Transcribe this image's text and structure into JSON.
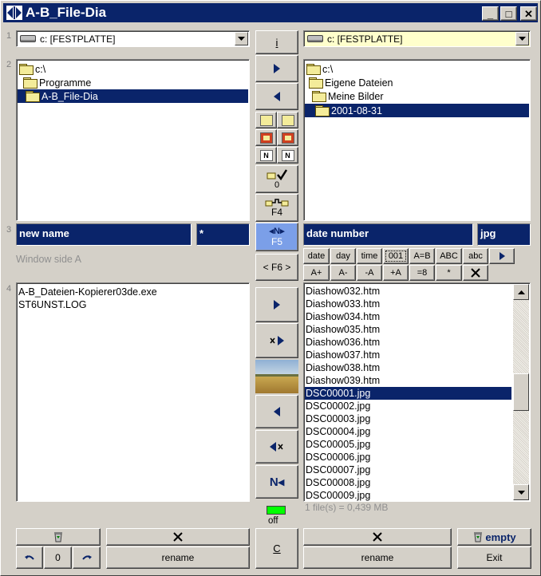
{
  "window": {
    "title": "A-B_File-Dia",
    "min_glyph": "_",
    "max_glyph": "□",
    "close_glyph": "✕"
  },
  "row_numbers": [
    "1",
    "2",
    "3",
    "4"
  ],
  "left": {
    "drive": "c: [FESTPLATTE]",
    "tree": [
      {
        "label": "c:\\",
        "indent": 0,
        "selected": false
      },
      {
        "label": "Programme",
        "indent": 1,
        "selected": false
      },
      {
        "label": "A-B_File-Dia",
        "indent": 2,
        "selected": true
      }
    ],
    "name_field": "new name",
    "ext_field": "*",
    "hint": "Window side A",
    "files": [
      "A-B_Dateien-Kopierer03de.exe",
      "ST6UNST.LOG"
    ]
  },
  "right": {
    "drive": "c: [FESTPLATTE]",
    "tree": [
      {
        "label": "c:\\",
        "indent": 0,
        "selected": false
      },
      {
        "label": "Eigene Dateien",
        "indent": 1,
        "selected": false
      },
      {
        "label": "Meine Bilder",
        "indent": 2,
        "selected": false
      },
      {
        "label": "2001-08-31",
        "indent": 3,
        "selected": true
      }
    ],
    "name_field": "date number",
    "ext_field": "jpg",
    "format_buttons_row1": [
      "date",
      "day",
      "time",
      "001",
      "A=B",
      "ABC",
      "abc"
    ],
    "format_buttons_row2": [
      "A+",
      "A-",
      "-A",
      "+A",
      "=8",
      "*"
    ],
    "files": [
      "Diashow032.htm",
      "Diashow033.htm",
      "Diashow034.htm",
      "Diashow035.htm",
      "Diashow036.htm",
      "Diashow037.htm",
      "Diashow038.htm",
      "Diashow039.htm",
      "DSC00001.jpg",
      "DSC00002.jpg",
      "DSC00003.jpg",
      "DSC00004.jpg",
      "DSC00005.jpg",
      "DSC00006.jpg",
      "DSC00007.jpg",
      "DSC00008.jpg",
      "DSC00009.jpg"
    ],
    "selected_file": "DSC00001.jpg",
    "status": "1  file(s)  = 0,439  MB"
  },
  "middle": {
    "info_label": "i",
    "count_label": "0",
    "f4_label": "F4",
    "f5_label": "F5",
    "f6_label": "< F6 >",
    "led_label": "off",
    "copy_label": "C"
  },
  "bottom": {
    "left_counter": "0",
    "left_rename": "rename",
    "right_rename": "rename",
    "empty_label": "empty",
    "exit_label": "Exit"
  },
  "colors": {
    "selection": "#0a246a",
    "led": "#00ff00",
    "f5_button": "#7b9fe8"
  }
}
